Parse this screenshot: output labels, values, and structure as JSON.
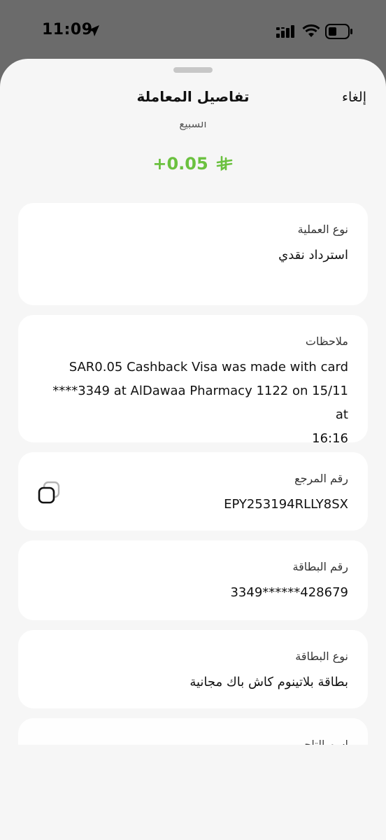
{
  "status_bar": {
    "time": "11:09",
    "icons": [
      "location-arrow-icon",
      "cellular-signal-icon",
      "wifi-icon",
      "battery-icon"
    ]
  },
  "sheet": {
    "title": "تفاصيل المعاملة",
    "cancel_label": "إلغاء"
  },
  "transaction": {
    "merchant": "السبيع",
    "amount": "+0.05",
    "amount_color": "#6bc13f",
    "currency_icon": "saudi-riyal-icon"
  },
  "details": {
    "type": {
      "label": "نوع العملية",
      "value": "استرداد نقدي"
    },
    "notes": {
      "label": "ملاحظات",
      "lines": [
        "SAR0.05 Cashback Visa was made with card",
        "****3349 at AlDawaa Pharmacy 1122 on 15/11 at",
        "16:16"
      ]
    },
    "reference": {
      "label": "رقم المرجع",
      "value": "EPY253194RLLY8SX",
      "copy_icon": "copy-icon"
    },
    "card_number": {
      "label": "رقم البطاقة",
      "value": "428679******3349"
    },
    "card_type": {
      "label": "نوع البطاقة",
      "value": "بطاقة بلاتينوم كاش باك مجانية"
    },
    "merchant_name": {
      "label": "اسم التاجر"
    }
  }
}
